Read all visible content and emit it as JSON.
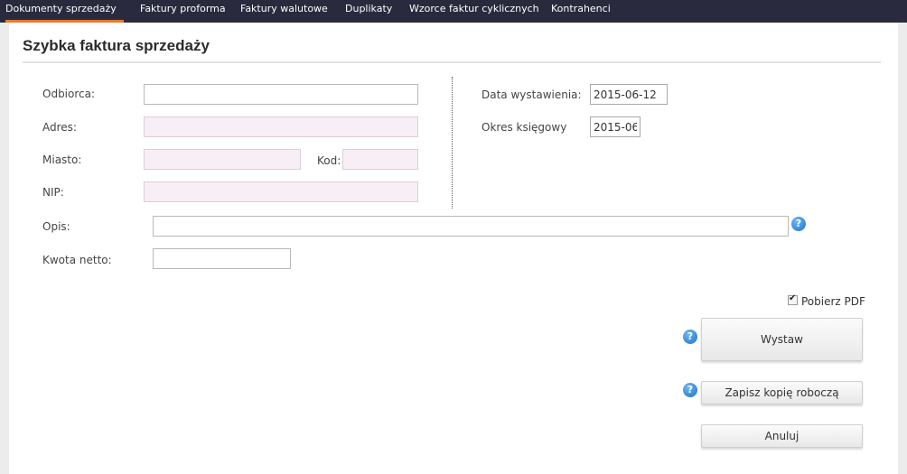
{
  "nav": {
    "tabs": [
      {
        "label": "Dokumenty sprzedaży",
        "active": true
      },
      {
        "label": "Faktury proforma"
      },
      {
        "label": "Faktury walutowe"
      },
      {
        "label": "Duplikaty"
      },
      {
        "label": "Wzorce faktur cyklicznych"
      },
      {
        "label": "Kontrahenci"
      }
    ]
  },
  "page": {
    "title": "Szybka faktura sprzedaży"
  },
  "form": {
    "odbiorca": {
      "label": "Odbiorca:",
      "value": ""
    },
    "adres": {
      "label": "Adres:",
      "value": ""
    },
    "miasto": {
      "label": "Miasto:",
      "value": ""
    },
    "kod": {
      "label": "Kod:",
      "value": ""
    },
    "nip": {
      "label": "NIP:",
      "value": ""
    },
    "data_wystawienia": {
      "label": "Data wystawienia:",
      "value": "2015-06-12"
    },
    "okres_ksiegowy": {
      "label": "Okres księgowy",
      "value": "2015-06"
    },
    "opis": {
      "label": "Opis:",
      "value": ""
    },
    "kwota_netto": {
      "label": "Kwota netto:",
      "value": ""
    }
  },
  "help_icon": {
    "glyph": "?",
    "icon": "help-icon",
    "color": "#1f73c9"
  },
  "pdf": {
    "label": "Pobierz PDF",
    "checked": true,
    "mark": "✔"
  },
  "actions": {
    "wystaw": "Wystaw",
    "zapisz": "Zapisz kopię roboczą",
    "anuluj": "Anuluj"
  },
  "colors": {
    "nav_bg": "#2a2a3e",
    "accent": "#e6792e",
    "locked_field": "#f7eff5"
  }
}
